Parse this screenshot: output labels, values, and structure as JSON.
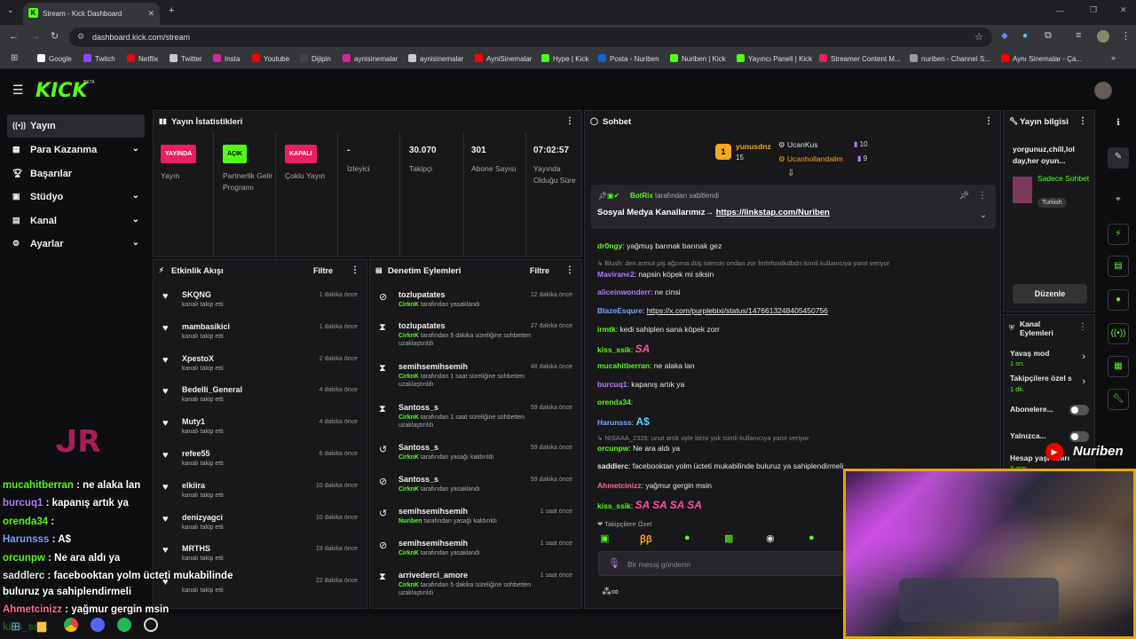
{
  "browser": {
    "tab_title": "Stream - Kick Dashboard",
    "url": "dashboard.kick.com/stream",
    "bookmarks": [
      "Google",
      "Twitch",
      "Netflix",
      "Twitter",
      "Insta",
      "Youtube",
      "Dijipin",
      "aynisinemalar",
      "aynisinemalar",
      "AyniSinemalar",
      "Hype | Kick",
      "Posta - Nuriben",
      "Nuriben | Kick",
      "Yayıncı Paneli | Kick",
      "Streamer Content M...",
      "nuriben - Channel S...",
      "Aynı Sinemalar - Ça..."
    ]
  },
  "header": {
    "logo": "KICK",
    "beta": "BETA"
  },
  "sidebar": {
    "items": [
      {
        "label": "Yayın"
      },
      {
        "label": "Para Kazanma"
      },
      {
        "label": "Başarılar"
      },
      {
        "label": "Stüdyo"
      },
      {
        "label": "Kanal"
      },
      {
        "label": "Ayarlar"
      }
    ]
  },
  "stats": {
    "title": "Yayın İstatistikleri",
    "items": [
      {
        "badge": "YAYINDA",
        "label": "Yayın"
      },
      {
        "badge": "AÇIK",
        "label": "Partnerlik Gelir Programı"
      },
      {
        "badge": "KAPALI",
        "label": "Çoklu Yayın"
      },
      {
        "value": "-",
        "label": "İzleyici"
      },
      {
        "value": "30.070",
        "label": "Takipçi"
      },
      {
        "value": "301",
        "label": "Abone Sayısı"
      },
      {
        "value": "07:02:57",
        "label": "Yayında Olduğu Süre"
      }
    ]
  },
  "activity": {
    "title": "Etkinlik Akışı",
    "filter": "Filtre",
    "rows": [
      {
        "name": "SKQNG",
        "sub": "kanalı takip etti",
        "time": "1 dakika önce"
      },
      {
        "name": "mambasikici",
        "sub": "kanalı takip etti",
        "time": "1 dakika önce"
      },
      {
        "name": "XpestoX",
        "sub": "kanalı takip etti",
        "time": "2 dakika önce"
      },
      {
        "name": "Bedelli_General",
        "sub": "kanalı takip etti",
        "time": "4 dakika önce"
      },
      {
        "name": "Muty1",
        "sub": "kanalı takip etti",
        "time": "4 dakika önce"
      },
      {
        "name": "refee55",
        "sub": "kanalı takip etti",
        "time": "6 dakika önce"
      },
      {
        "name": "elkiira",
        "sub": "kanalı takip etti",
        "time": "10 dakika önce"
      },
      {
        "name": "denizyagci",
        "sub": "kanalı takip etti",
        "time": "10 dakika önce"
      },
      {
        "name": "MRTHS",
        "sub": "kanalı takip etti",
        "time": "19 dakika önce"
      },
      {
        "name": "",
        "sub": "kanalı takip etti",
        "time": "22 dakika önce"
      }
    ]
  },
  "moderation": {
    "title": "Denetim Eylemleri",
    "filter": "Filtre",
    "rows": [
      {
        "name": "tozlupatates",
        "mod": "CirknK",
        "sub": "tarafından yasaklandı",
        "time": "12 dakika önce",
        "icon": "⊘"
      },
      {
        "name": "tozlupatates",
        "mod": "CirknK",
        "sub": "tarafından 5 dakika süreliğine sohbetten uzaklaştırıldı",
        "time": "27 dakika önce",
        "icon": "⧗"
      },
      {
        "name": "semihsemihsemih",
        "mod": "CirknK",
        "sub": "tarafından 1 saat süreliğine sohbetten uzaklaştırıldı",
        "time": "48 dakika önce",
        "icon": "⧗"
      },
      {
        "name": "Santoss_s",
        "mod": "CirknK",
        "sub": "tarafından 1 saat süreliğine sohbetten uzaklaştırıldı",
        "time": "59 dakika önce",
        "icon": "⧗"
      },
      {
        "name": "Santoss_s",
        "mod": "CirknK",
        "sub": "tarafından yasağı kaldırıldı",
        "time": "59 dakika önce",
        "icon": "↺"
      },
      {
        "name": "Santoss_s",
        "mod": "CirknK",
        "sub": "tarafından yasaklandı",
        "time": "59 dakika önce",
        "icon": "⊘"
      },
      {
        "name": "semihsemihsemih",
        "mod": "Nuriben",
        "sub": "tarafından yasağı kaldırıldı",
        "time": "1 saat önce",
        "icon": "↺"
      },
      {
        "name": "semihsemihsemih",
        "mod": "CirknK",
        "sub": "tarafından yasaklandı",
        "time": "1 saat önce",
        "icon": "⊘"
      },
      {
        "name": "arrivederci_amore",
        "mod": "CirknK",
        "sub": "tarafından 5 dakika süreliğine sohbetten uzaklaştırıldı",
        "time": "1 saat önce",
        "icon": "⧗"
      }
    ]
  },
  "chat": {
    "title": "Sohbet",
    "top": [
      {
        "name": "yunusdnz",
        "count": "15"
      },
      {
        "name": "UcanKus",
        "count": "10"
      },
      {
        "name": "Ucanhollandalim",
        "count": "9"
      }
    ],
    "pinned": {
      "by": "BotRix",
      "by_suffix": "tarafından sabitlendi",
      "text": "Sosyal Medya Kanallarımız→ ",
      "link": "https://linkstap.com/Nuriben"
    },
    "messages": [
      {
        "user": "dr0ngy",
        "text": "yağmuş barınak barınak gez",
        "color": "#53fc18"
      },
      {
        "sys": "↳ Blush: den armut piş ağzıma düş istersin ondan zor fmfnfsndkdbdn isimli kullanıcıya yanıt veriyor"
      },
      {
        "user": "Mavirane2",
        "text": "napsin köpek mi siksin",
        "color": "#b47cff"
      },
      {
        "user": "aliceinwonderr",
        "text": "ne cinsi",
        "color": "#b47cff"
      },
      {
        "user": "BlazeEsqure",
        "text": "https://x.com/purplebixi/status/1476613248405450756",
        "color": "#7aa2ff"
      },
      {
        "user": "irmtk",
        "text": "kedi sahiplen sana köpek zorr",
        "color": "#53fc18"
      },
      {
        "user": "kiss_ssik",
        "text": "SA",
        "color": "#53fc18"
      },
      {
        "user": "mucahitberran",
        "text": "ne alaka lan",
        "color": "#53fc18"
      },
      {
        "user": "burcuq1",
        "text": "kapanış artık ya",
        "color": "#b47cff"
      },
      {
        "user": "orenda34",
        "text": "",
        "color": "#53fc18"
      },
      {
        "user": "Harunsss",
        "text": "A$",
        "color": "#7aa2ff"
      },
      {
        "sys": "↳ NISAAA_2326: unut artık oyle birisi yok isimli kullanıcıya yanıt veriyor"
      },
      {
        "user": "orcunpw",
        "text": "Ne ara aldı ya",
        "color": "#53fc18"
      },
      {
        "user": "saddlerc",
        "text": "facebooktan yolm ücteti mukabilinde buluruz ya sahiplendirmeli",
        "color": "#e8e8e8"
      },
      {
        "user": "Ahmetcinizz",
        "text": "yağmur gergin msin",
        "color": "#ff6b8a"
      },
      {
        "user": "kiss_ssik",
        "text": "SA SA SA SA",
        "color": "#53fc18"
      }
    ],
    "followers_only": "Takipçilere Özel",
    "input_placeholder": "Bir mesaj gönderin"
  },
  "stream_info": {
    "title": "Yayın bilgisi",
    "desc": "yorgunuz,chill,lol day,her oyun...",
    "category": "Sadece Sohbet",
    "language": "Turkish",
    "edit": "Düzenle"
  },
  "channel_actions": {
    "title": "Kanal Eylemleri",
    "items": [
      {
        "label": "Yavaş mod",
        "value": "1 sn."
      },
      {
        "label": "Takipçilere özel s",
        "value": "1 dk."
      },
      {
        "label": "Abonelere..."
      },
      {
        "label": "Yalnızca..."
      },
      {
        "label": "Hesap yaşı sınırı",
        "value": "3 gün"
      }
    ]
  },
  "overlay": {
    "brand": "Nuriben",
    "chat": [
      {
        "user": "mucahitberran",
        "text": " : ne alaka lan",
        "color": "#53fc18"
      },
      {
        "user": "burcuq1",
        "text": " : kapanış artık ya",
        "color": "#b47cff"
      },
      {
        "user": "orenda34",
        "text": " : ",
        "color": "#53fc18"
      },
      {
        "user": "Harunsss",
        "text": " : A$",
        "color": "#7aa2ff"
      },
      {
        "user": "orcunpw",
        "text": " : Ne ara aldı ya",
        "color": "#53fc18"
      },
      {
        "user": "saddlerc",
        "text": " : facebooktan yolm ücteti mukabilinde",
        "color": "#e8e8e8"
      },
      {
        "user": "",
        "text": "buluruz ya sahiplendirmeli",
        "color": "#e8e8e8"
      },
      {
        "user": "Ahmetcinizz",
        "text": " : yağmur gergin msin",
        "color": "#ff6b8a"
      },
      {
        "user": "kiss_ssik",
        "text": "",
        "color": "#53fc18"
      }
    ]
  }
}
